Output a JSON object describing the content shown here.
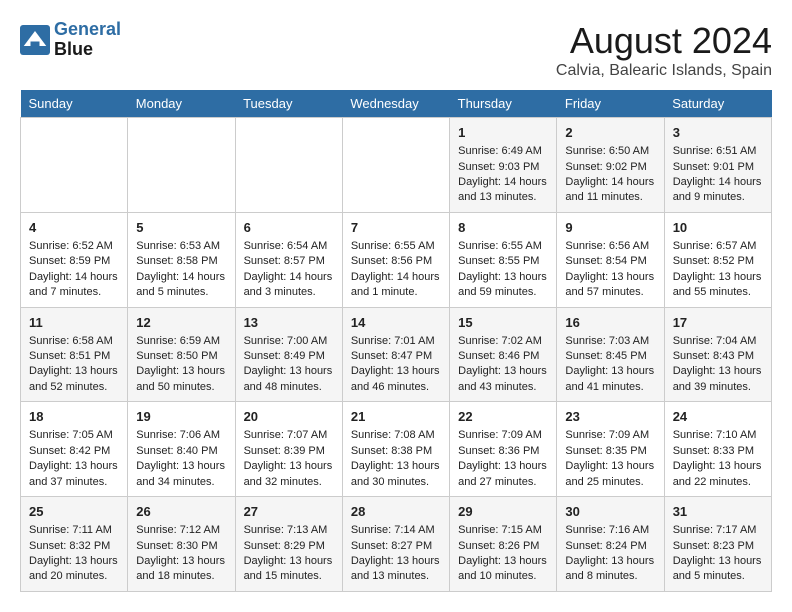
{
  "header": {
    "logo_line1": "General",
    "logo_line2": "Blue",
    "title": "August 2024",
    "subtitle": "Calvia, Balearic Islands, Spain"
  },
  "days_of_week": [
    "Sunday",
    "Monday",
    "Tuesday",
    "Wednesday",
    "Thursday",
    "Friday",
    "Saturday"
  ],
  "weeks": [
    [
      {
        "day": "",
        "info": ""
      },
      {
        "day": "",
        "info": ""
      },
      {
        "day": "",
        "info": ""
      },
      {
        "day": "",
        "info": ""
      },
      {
        "day": "1",
        "info": "Sunrise: 6:49 AM\nSunset: 9:03 PM\nDaylight: 14 hours\nand 13 minutes."
      },
      {
        "day": "2",
        "info": "Sunrise: 6:50 AM\nSunset: 9:02 PM\nDaylight: 14 hours\nand 11 minutes."
      },
      {
        "day": "3",
        "info": "Sunrise: 6:51 AM\nSunset: 9:01 PM\nDaylight: 14 hours\nand 9 minutes."
      }
    ],
    [
      {
        "day": "4",
        "info": "Sunrise: 6:52 AM\nSunset: 8:59 PM\nDaylight: 14 hours\nand 7 minutes."
      },
      {
        "day": "5",
        "info": "Sunrise: 6:53 AM\nSunset: 8:58 PM\nDaylight: 14 hours\nand 5 minutes."
      },
      {
        "day": "6",
        "info": "Sunrise: 6:54 AM\nSunset: 8:57 PM\nDaylight: 14 hours\nand 3 minutes."
      },
      {
        "day": "7",
        "info": "Sunrise: 6:55 AM\nSunset: 8:56 PM\nDaylight: 14 hours\nand 1 minute."
      },
      {
        "day": "8",
        "info": "Sunrise: 6:55 AM\nSunset: 8:55 PM\nDaylight: 13 hours\nand 59 minutes."
      },
      {
        "day": "9",
        "info": "Sunrise: 6:56 AM\nSunset: 8:54 PM\nDaylight: 13 hours\nand 57 minutes."
      },
      {
        "day": "10",
        "info": "Sunrise: 6:57 AM\nSunset: 8:52 PM\nDaylight: 13 hours\nand 55 minutes."
      }
    ],
    [
      {
        "day": "11",
        "info": "Sunrise: 6:58 AM\nSunset: 8:51 PM\nDaylight: 13 hours\nand 52 minutes."
      },
      {
        "day": "12",
        "info": "Sunrise: 6:59 AM\nSunset: 8:50 PM\nDaylight: 13 hours\nand 50 minutes."
      },
      {
        "day": "13",
        "info": "Sunrise: 7:00 AM\nSunset: 8:49 PM\nDaylight: 13 hours\nand 48 minutes."
      },
      {
        "day": "14",
        "info": "Sunrise: 7:01 AM\nSunset: 8:47 PM\nDaylight: 13 hours\nand 46 minutes."
      },
      {
        "day": "15",
        "info": "Sunrise: 7:02 AM\nSunset: 8:46 PM\nDaylight: 13 hours\nand 43 minutes."
      },
      {
        "day": "16",
        "info": "Sunrise: 7:03 AM\nSunset: 8:45 PM\nDaylight: 13 hours\nand 41 minutes."
      },
      {
        "day": "17",
        "info": "Sunrise: 7:04 AM\nSunset: 8:43 PM\nDaylight: 13 hours\nand 39 minutes."
      }
    ],
    [
      {
        "day": "18",
        "info": "Sunrise: 7:05 AM\nSunset: 8:42 PM\nDaylight: 13 hours\nand 37 minutes."
      },
      {
        "day": "19",
        "info": "Sunrise: 7:06 AM\nSunset: 8:40 PM\nDaylight: 13 hours\nand 34 minutes."
      },
      {
        "day": "20",
        "info": "Sunrise: 7:07 AM\nSunset: 8:39 PM\nDaylight: 13 hours\nand 32 minutes."
      },
      {
        "day": "21",
        "info": "Sunrise: 7:08 AM\nSunset: 8:38 PM\nDaylight: 13 hours\nand 30 minutes."
      },
      {
        "day": "22",
        "info": "Sunrise: 7:09 AM\nSunset: 8:36 PM\nDaylight: 13 hours\nand 27 minutes."
      },
      {
        "day": "23",
        "info": "Sunrise: 7:09 AM\nSunset: 8:35 PM\nDaylight: 13 hours\nand 25 minutes."
      },
      {
        "day": "24",
        "info": "Sunrise: 7:10 AM\nSunset: 8:33 PM\nDaylight: 13 hours\nand 22 minutes."
      }
    ],
    [
      {
        "day": "25",
        "info": "Sunrise: 7:11 AM\nSunset: 8:32 PM\nDaylight: 13 hours\nand 20 minutes."
      },
      {
        "day": "26",
        "info": "Sunrise: 7:12 AM\nSunset: 8:30 PM\nDaylight: 13 hours\nand 18 minutes."
      },
      {
        "day": "27",
        "info": "Sunrise: 7:13 AM\nSunset: 8:29 PM\nDaylight: 13 hours\nand 15 minutes."
      },
      {
        "day": "28",
        "info": "Sunrise: 7:14 AM\nSunset: 8:27 PM\nDaylight: 13 hours\nand 13 minutes."
      },
      {
        "day": "29",
        "info": "Sunrise: 7:15 AM\nSunset: 8:26 PM\nDaylight: 13 hours\nand 10 minutes."
      },
      {
        "day": "30",
        "info": "Sunrise: 7:16 AM\nSunset: 8:24 PM\nDaylight: 13 hours\nand 8 minutes."
      },
      {
        "day": "31",
        "info": "Sunrise: 7:17 AM\nSunset: 8:23 PM\nDaylight: 13 hours\nand 5 minutes."
      }
    ]
  ]
}
